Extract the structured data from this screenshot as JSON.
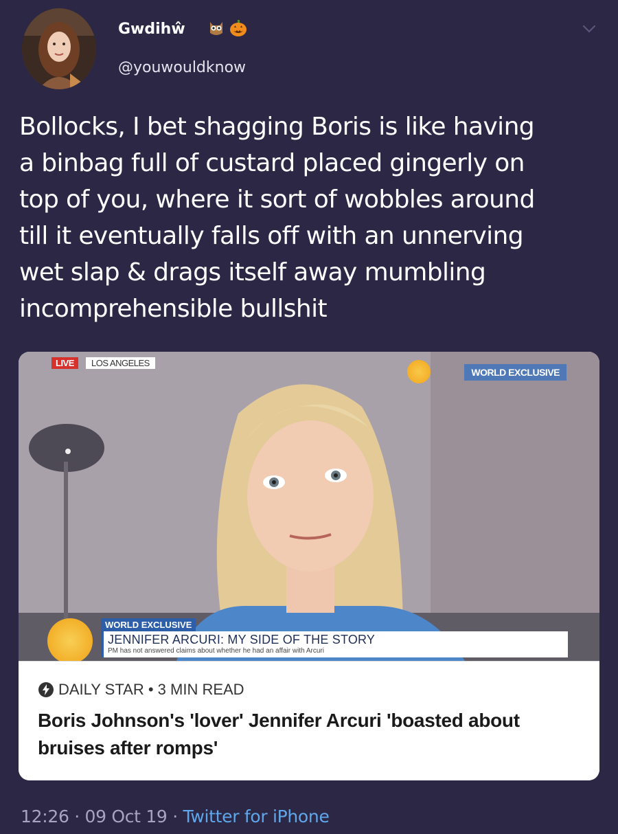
{
  "tweet": {
    "display_name": "Gwdihŵ",
    "handle": "@youwouldknow",
    "name_emojis": [
      "owl-emoji",
      "pumpkin-emoji"
    ],
    "text": "Bollocks, I bet shagging Boris is like having\na binbag full of custard placed gingerly on\ntop of you, where it sort of wobbles around\ntill it eventually falls off with an unnerving\nwet slap & drags itself away mumbling\nincomprehensible bullshit",
    "time": "12:26",
    "date": "09 Oct 19",
    "client": "Twitter for iPhone",
    "separator": " · "
  },
  "card": {
    "media": {
      "live_label": "LIVE",
      "location_label": "LOS ANGELES",
      "top_exclusive_label": "WORLD EXCLUSIVE",
      "lower_tag": "WORLD EXCLUSIVE",
      "lower_headline": "JENNIFER ARCURI: MY SIDE OF THE STORY",
      "lower_sub": "PM has not answered claims about whether he had an affair with Arcuri"
    },
    "source": "DAILY STAR",
    "read_time": "3 MIN READ",
    "source_separator": " • ",
    "title": "Boris Johnson's 'lover' Jennifer Arcuri 'boasted about bruises after romps'"
  },
  "colors": {
    "background": "#2b2745",
    "link": "#5fa7ea",
    "muted": "#a8a4c0",
    "card_bg": "#ffffff"
  }
}
